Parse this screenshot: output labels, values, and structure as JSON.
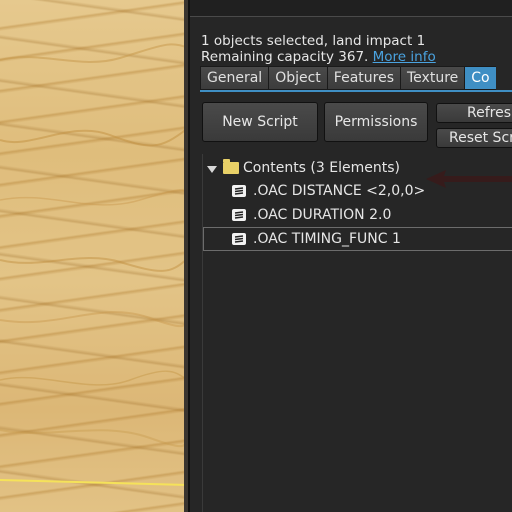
{
  "info": {
    "line1": "1 objects selected, land impact 1",
    "line2_prefix": "Remaining capacity 367.",
    "more_info_link": "More info"
  },
  "tabs": [
    {
      "label": "General",
      "active": false
    },
    {
      "label": "Object",
      "active": false
    },
    {
      "label": "Features",
      "active": false
    },
    {
      "label": "Texture",
      "active": false
    },
    {
      "label": "Co",
      "active": true
    }
  ],
  "buttons": {
    "new_script": "New Script",
    "permissions": "Permissions",
    "refresh": "Refres",
    "reset_scripts": "Reset Scr"
  },
  "contents": {
    "folder_label": "Contents (3 Elements)",
    "items": [
      {
        "label": ".OAC DISTANCE <2,0,0>",
        "icon": "script-icon",
        "selected": false
      },
      {
        "label": ".OAC DURATION 2.0",
        "icon": "script-icon",
        "selected": false
      },
      {
        "label": ".OAC TIMING_FUNC 1",
        "icon": "script-icon",
        "selected": true
      }
    ]
  },
  "colors": {
    "accent": "#3f8fc4",
    "link": "#4aa3e0",
    "panel_bg": "#262626",
    "folder": "#e8d067"
  }
}
